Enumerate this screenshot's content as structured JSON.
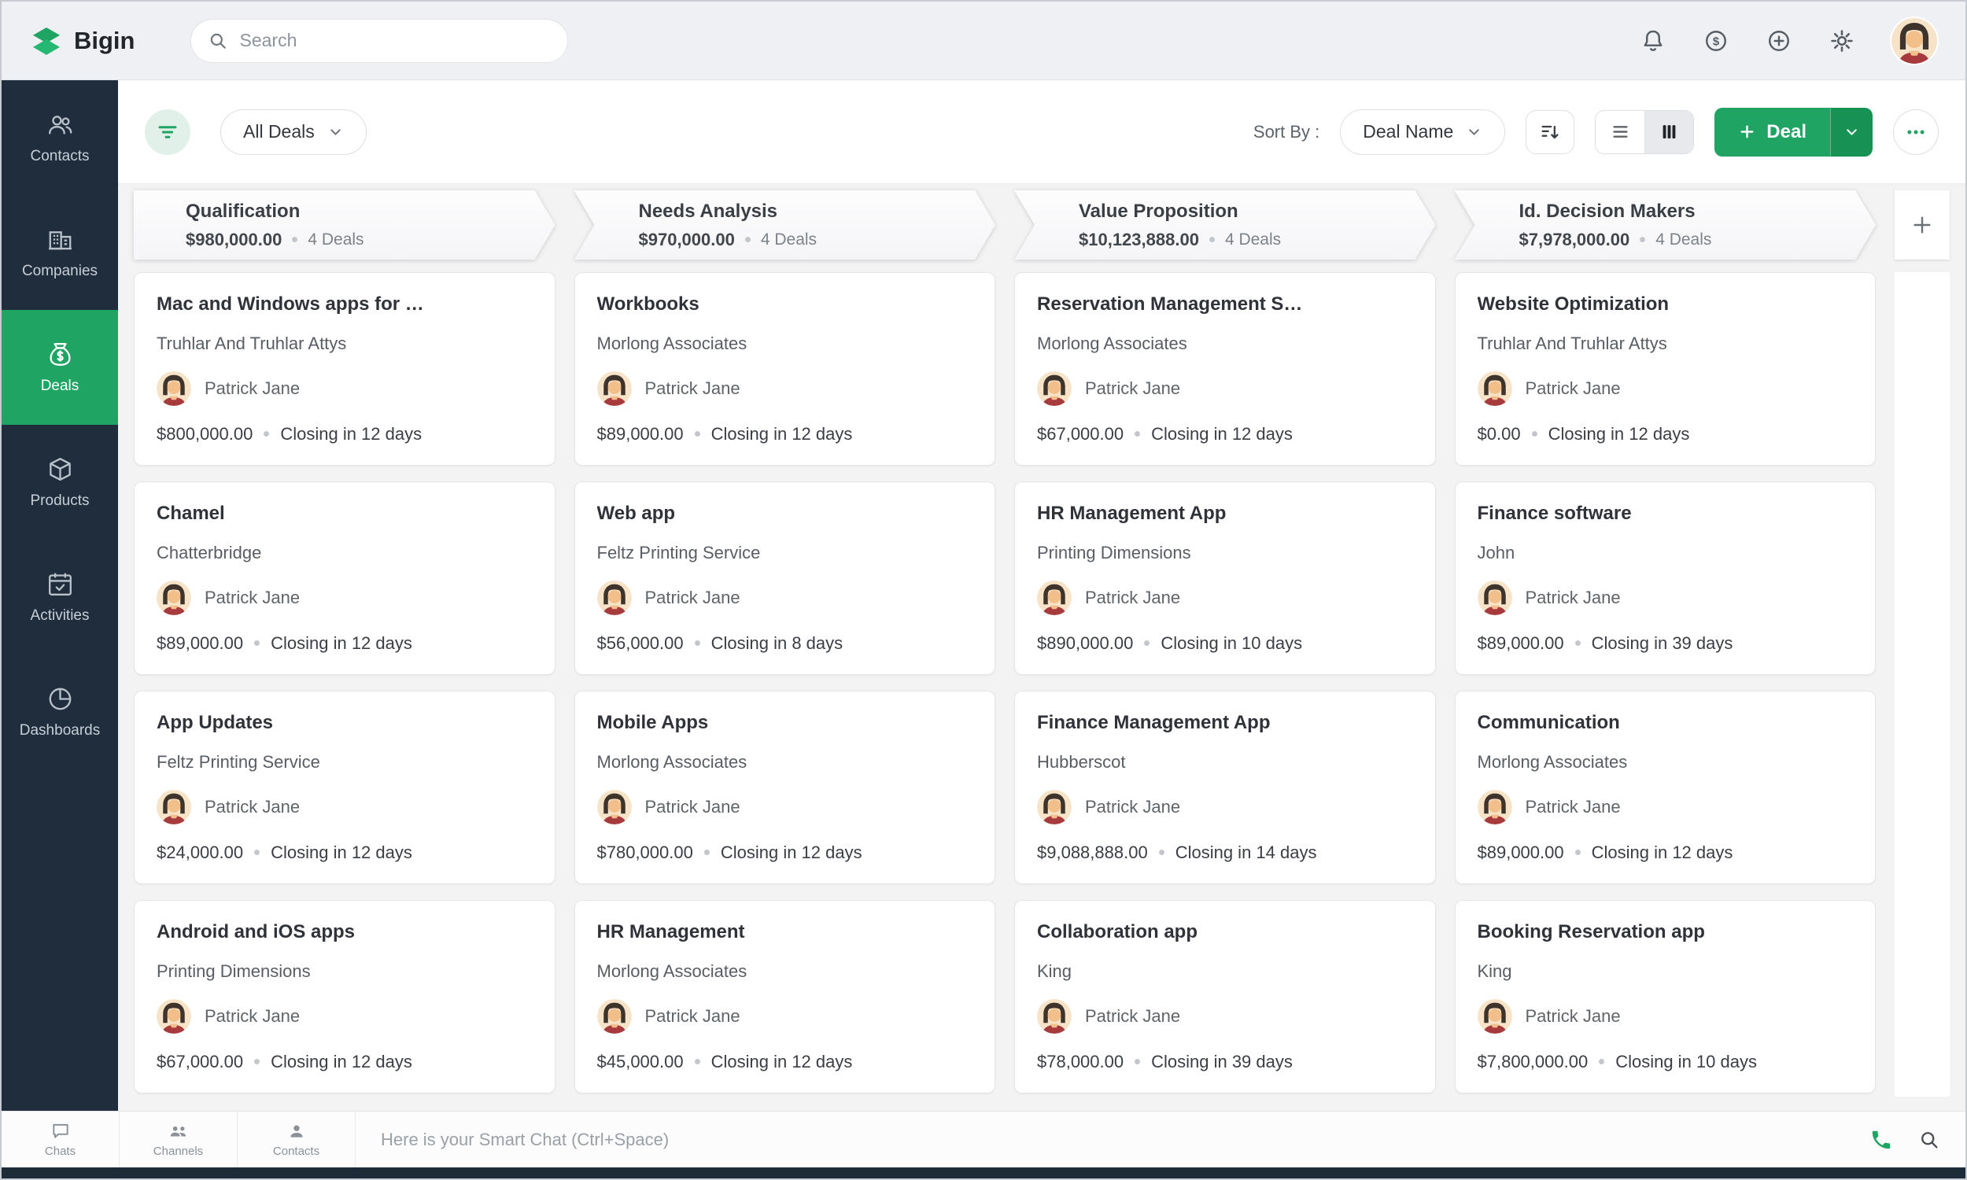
{
  "topbar": {
    "brand": "Bigin",
    "search": {
      "placeholder": "Search"
    }
  },
  "sidebar": {
    "items": [
      {
        "label": "Contacts"
      },
      {
        "label": "Companies"
      },
      {
        "label": "Deals"
      },
      {
        "label": "Products"
      },
      {
        "label": "Activities"
      },
      {
        "label": "Dashboards"
      }
    ]
  },
  "toolbar": {
    "view_filter_label": "All Deals",
    "sort_by_label": "Sort By :",
    "sort_value": "Deal Name",
    "new_deal_label": "Deal"
  },
  "board": {
    "columns": [
      {
        "title": "Qualification",
        "amount": "$980,000.00",
        "deals_count": "4 Deals",
        "cards": [
          {
            "title": "Mac and Windows apps for …",
            "company": "Truhlar And Truhlar Attys",
            "owner": "Patrick Jane",
            "amount": "$800,000.00",
            "closing": "Closing in 12 days"
          },
          {
            "title": "Chamel",
            "company": "Chatterbridge",
            "owner": "Patrick Jane",
            "amount": "$89,000.00",
            "closing": "Closing in 12 days"
          },
          {
            "title": "App Updates",
            "company": "Feltz Printing Service",
            "owner": "Patrick Jane",
            "amount": "$24,000.00",
            "closing": "Closing in 12 days"
          },
          {
            "title": "Android and iOS apps",
            "company": "Printing Dimensions",
            "owner": "Patrick Jane",
            "amount": "$67,000.00",
            "closing": "Closing in 12 days"
          }
        ]
      },
      {
        "title": "Needs Analysis",
        "amount": "$970,000.00",
        "deals_count": "4 Deals",
        "cards": [
          {
            "title": "Workbooks",
            "company": "Morlong Associates",
            "owner": "Patrick Jane",
            "amount": "$89,000.00",
            "closing": "Closing in 12 days"
          },
          {
            "title": "Web app",
            "company": "Feltz Printing Service",
            "owner": "Patrick Jane",
            "amount": "$56,000.00",
            "closing": "Closing in 8 days"
          },
          {
            "title": "Mobile Apps",
            "company": "Morlong Associates",
            "owner": "Patrick Jane",
            "amount": "$780,000.00",
            "closing": "Closing in 12 days"
          },
          {
            "title": "HR Management",
            "company": "Morlong Associates",
            "owner": "Patrick Jane",
            "amount": "$45,000.00",
            "closing": "Closing in 12 days"
          }
        ]
      },
      {
        "title": "Value Proposition",
        "amount": "$10,123,888.00",
        "deals_count": "4 Deals",
        "cards": [
          {
            "title": "Reservation Management S…",
            "company": "Morlong Associates",
            "owner": "Patrick Jane",
            "amount": "$67,000.00",
            "closing": "Closing in 12 days"
          },
          {
            "title": "HR Management App",
            "company": "Printing Dimensions",
            "owner": "Patrick Jane",
            "amount": "$890,000.00",
            "closing": "Closing in 10 days"
          },
          {
            "title": "Finance Management App",
            "company": "Hubberscot",
            "owner": "Patrick Jane",
            "amount": "$9,088,888.00",
            "closing": "Closing in 14 days"
          },
          {
            "title": "Collaboration app",
            "company": "King",
            "owner": "Patrick Jane",
            "amount": "$78,000.00",
            "closing": "Closing in 39 days"
          }
        ]
      },
      {
        "title": "Id. Decision Makers",
        "amount": "$7,978,000.00",
        "deals_count": "4 Deals",
        "cards": [
          {
            "title": "Website Optimization",
            "company": "Truhlar And Truhlar Attys",
            "owner": "Patrick Jane",
            "amount": "$0.00",
            "closing": "Closing in 12 days"
          },
          {
            "title": "Finance software",
            "company": "John",
            "owner": "Patrick Jane",
            "amount": "$89,000.00",
            "closing": "Closing in 39 days"
          },
          {
            "title": "Communication",
            "company": "Morlong Associates",
            "owner": "Patrick Jane",
            "amount": "$89,000.00",
            "closing": "Closing in 12 days"
          },
          {
            "title": "Booking Reservation app",
            "company": "King",
            "owner": "Patrick Jane",
            "amount": "$7,800,000.00",
            "closing": "Closing in 10 days"
          }
        ]
      }
    ]
  },
  "bottombar": {
    "tabs": [
      {
        "label": "Chats"
      },
      {
        "label": "Channels"
      },
      {
        "label": "Contacts"
      }
    ],
    "chat_placeholder": "Here is your Smart Chat (Ctrl+Space)"
  },
  "colors": {
    "accent_green": "#1fa463",
    "sidebar_bg": "#1f2d3c"
  }
}
